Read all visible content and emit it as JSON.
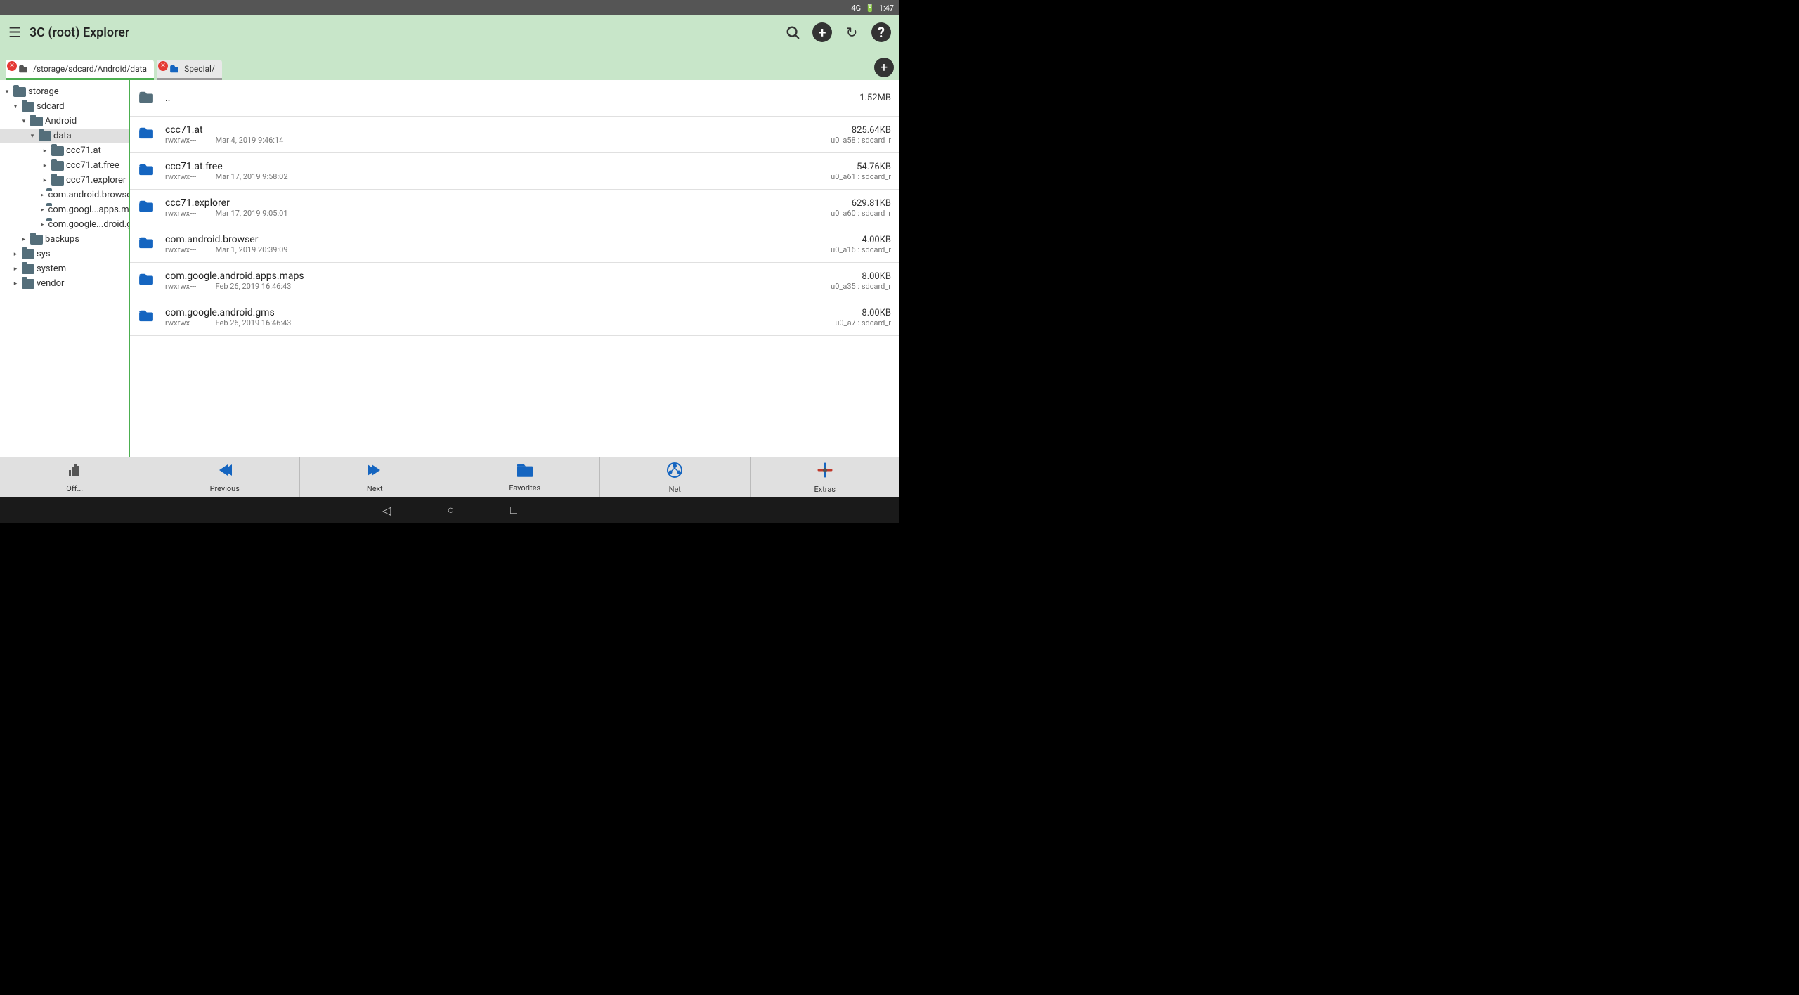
{
  "statusBar": {
    "signal": "4G",
    "battery": "🔋",
    "time": "1:47"
  },
  "appBar": {
    "title": "3C (root) Explorer",
    "menuIcon": "☰",
    "searchIcon": "🔍",
    "addIcon": "+",
    "refreshIcon": "↻",
    "helpIcon": "?"
  },
  "tabs": [
    {
      "id": "tab1",
      "label": "/storage/sdcard/Android/data",
      "active": true
    },
    {
      "id": "tab2",
      "label": "Special/",
      "active": false
    }
  ],
  "treeItems": [
    {
      "level": 0,
      "label": "storage",
      "expanded": true,
      "selected": false
    },
    {
      "level": 1,
      "label": "sdcard",
      "expanded": true,
      "selected": false
    },
    {
      "level": 2,
      "label": "Android",
      "expanded": true,
      "selected": false
    },
    {
      "level": 3,
      "label": "data",
      "expanded": true,
      "selected": true
    },
    {
      "level": 4,
      "label": "ccc71.at",
      "expanded": false,
      "selected": false
    },
    {
      "level": 4,
      "label": "ccc71.at.free",
      "expanded": false,
      "selected": false
    },
    {
      "level": 4,
      "label": "ccc71.explorer",
      "expanded": false,
      "selected": false
    },
    {
      "level": 4,
      "label": "com.android.browser",
      "expanded": false,
      "selected": false
    },
    {
      "level": 4,
      "label": "com.googl...apps.maps",
      "expanded": false,
      "selected": false
    },
    {
      "level": 4,
      "label": "com.google...droid.gms",
      "expanded": false,
      "selected": false
    },
    {
      "level": 2,
      "label": "backups",
      "expanded": false,
      "selected": false
    },
    {
      "level": 1,
      "label": "sys",
      "expanded": false,
      "selected": false
    },
    {
      "level": 1,
      "label": "system",
      "expanded": false,
      "selected": false
    },
    {
      "level": 1,
      "label": "vendor",
      "expanded": false,
      "selected": false
    }
  ],
  "fileList": [
    {
      "name": "..",
      "isParent": true,
      "permissions": "",
      "date": "",
      "size": "1.52MB",
      "owner": ""
    },
    {
      "name": "ccc71.at",
      "isParent": false,
      "permissions": "rwxrwx---",
      "date": "Mar 4, 2019 9:46:14",
      "size": "825.64KB",
      "owner": "u0_a58 : sdcard_r"
    },
    {
      "name": "ccc71.at.free",
      "isParent": false,
      "permissions": "rwxrwx---",
      "date": "Mar 17, 2019 9:58:02",
      "size": "54.76KB",
      "owner": "u0_a61 : sdcard_r"
    },
    {
      "name": "ccc71.explorer",
      "isParent": false,
      "permissions": "rwxrwx---",
      "date": "Mar 17, 2019 9:05:01",
      "size": "629.81KB",
      "owner": "u0_a60 : sdcard_r"
    },
    {
      "name": "com.android.browser",
      "isParent": false,
      "permissions": "rwxrwx---",
      "date": "Mar 1, 2019 20:39:09",
      "size": "4.00KB",
      "owner": "u0_a16 : sdcard_r"
    },
    {
      "name": "com.google.android.apps.maps",
      "isParent": false,
      "permissions": "rwxrwx---",
      "date": "Feb 26, 2019 16:46:43",
      "size": "8.00KB",
      "owner": "u0_a35 : sdcard_r"
    },
    {
      "name": "com.google.android.gms",
      "isParent": false,
      "permissions": "rwxrwx---",
      "date": "Feb 26, 2019 16:46:43",
      "size": "8.00KB",
      "owner": "u0_a7 : sdcard_r"
    }
  ],
  "bottomBar": {
    "buttons": [
      {
        "id": "off",
        "label": "Off...",
        "icon": "📊"
      },
      {
        "id": "previous",
        "label": "Previous",
        "icon": "◀"
      },
      {
        "id": "next",
        "label": "Next",
        "icon": "▶"
      },
      {
        "id": "favorites",
        "label": "Favorites",
        "icon": "📁"
      },
      {
        "id": "net",
        "label": "Net",
        "icon": "🌐"
      },
      {
        "id": "extras",
        "label": "Extras",
        "icon": "🔧"
      }
    ]
  },
  "navBar": {
    "backIcon": "◁",
    "homeIcon": "○",
    "recentIcon": "□"
  }
}
